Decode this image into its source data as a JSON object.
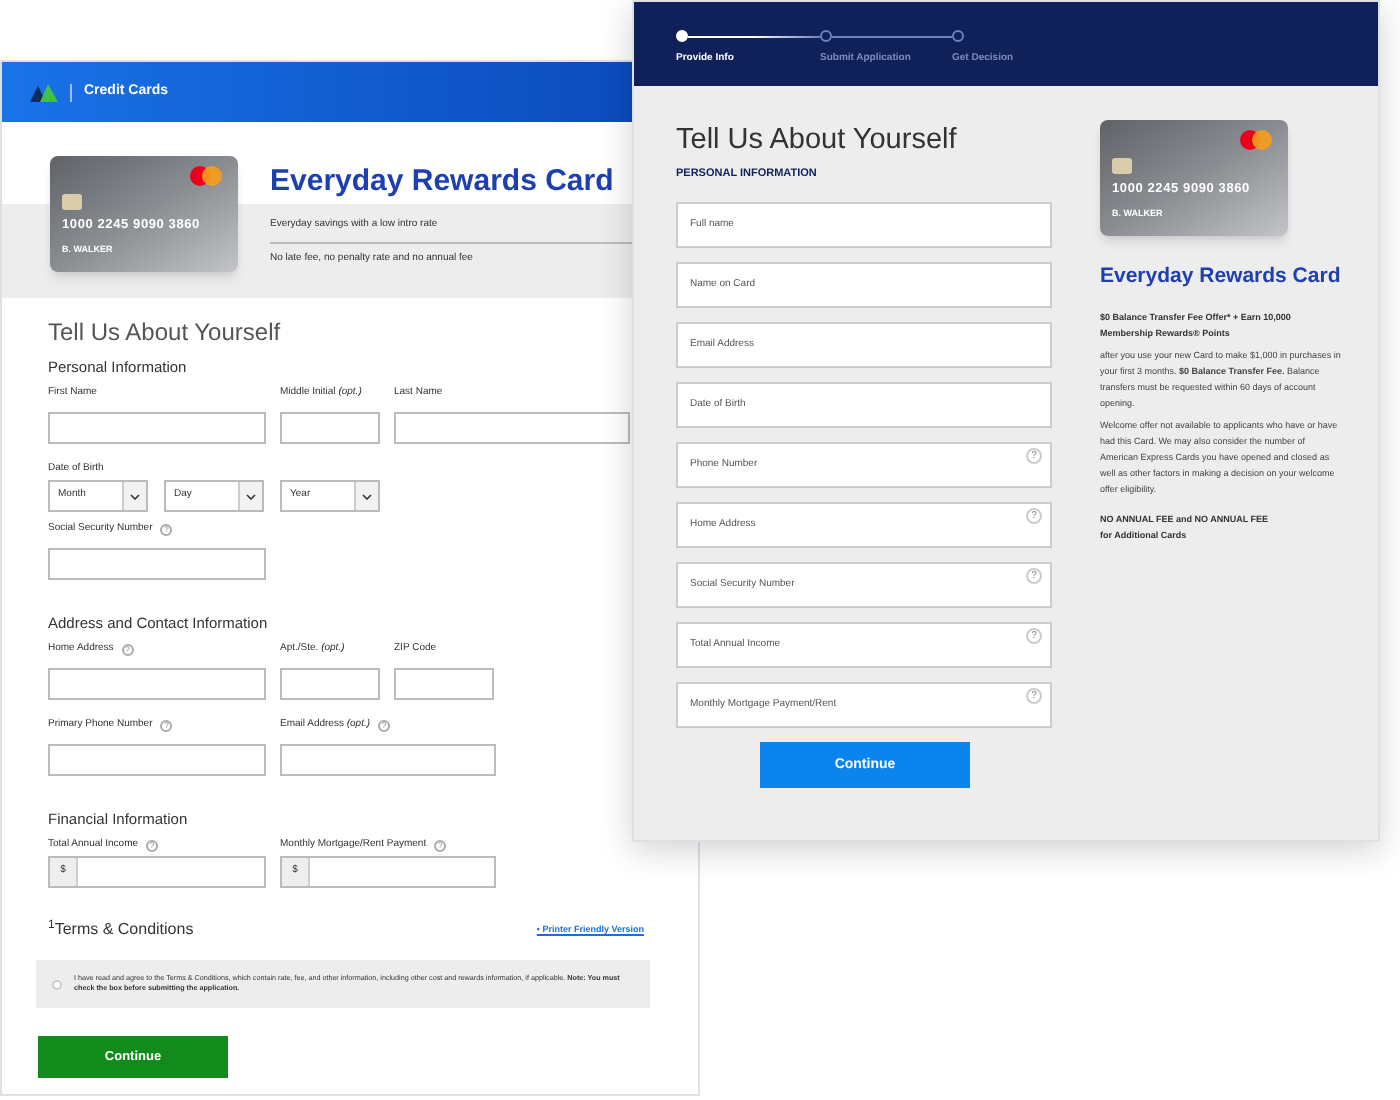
{
  "left_page": {
    "header": {
      "title": "Credit Cards"
    },
    "product": {
      "title": "Everyday Rewards Card",
      "card": {
        "number": "1000 2245 9090 3860",
        "holder": "B. WALKER"
      },
      "features": [
        "Everyday savings with a low intro rate",
        "No late fee, no penalty rate and no annual fee"
      ]
    },
    "heading": "Tell Us About Yourself",
    "sections": [
      {
        "title": "Personal Information",
        "rows": [
          [
            {
              "label": "First Name",
              "kind": "text"
            },
            {
              "label": "Middle Initial *(opt.)*",
              "kind": "text"
            },
            {
              "label": "Last Name",
              "kind": "text"
            }
          ],
          [
            {
              "label": "Date of Birth",
              "kind": "selects",
              "selects": [
                "Month",
                "Day",
                "Year"
              ]
            }
          ],
          [
            {
              "label": "Social Security Number",
              "kind": "text",
              "help": "?"
            }
          ]
        ]
      },
      {
        "title": "Address and Contact Information",
        "rows": [
          [
            {
              "label": "Home Address",
              "kind": "text",
              "help": "?"
            },
            {
              "label": "Apt./Ste. *(opt.)*",
              "kind": "text"
            },
            {
              "label": "ZIP Code",
              "kind": "text"
            }
          ],
          [
            {
              "label": "Primary Phone Number",
              "kind": "text",
              "help": "?"
            },
            {
              "label": "Email Address *(opt.)*",
              "kind": "text",
              "help": "?"
            }
          ]
        ]
      },
      {
        "title": "Financial Information",
        "rows": [
          [
            {
              "label": "Total Annual Income",
              "kind": "currency",
              "prefix": "$",
              "help": "?"
            },
            {
              "label": "Monthly Mortgage/Rent Payment",
              "kind": "currency",
              "prefix": "$",
              "help": "?"
            }
          ]
        ]
      }
    ],
    "terms": {
      "title": "$^{1}$Terms & Conditions",
      "link": "• Printer Friendly Version",
      "agreement": "I have read and agree to the Terms & Conditions, which contain rate, fee, and other information, including other cost and rewards information, if applicable. **Note: You must check the box before submitting the application.**",
      "checked": false
    },
    "button": "Continue"
  },
  "right_page": {
    "steps": [
      {
        "label": "Provide Info",
        "selected": true
      },
      {
        "label": "Submit Application",
        "selected": false
      },
      {
        "label": "Get Decision",
        "selected": false
      }
    ],
    "heading": "Tell Us About Yourself",
    "section": "PERSONAL INFORMATION",
    "fields": [
      {
        "placeholder": "Full name"
      },
      {
        "placeholder": "Name on Card"
      },
      {
        "placeholder": "Email Address"
      },
      {
        "placeholder": "Date of Birth"
      },
      {
        "placeholder": "Phone Number",
        "help": "?"
      },
      {
        "placeholder": "Home Address",
        "help": "?"
      },
      {
        "placeholder": "Social Security Number",
        "help": "?"
      },
      {
        "placeholder": "Total Annual Income",
        "help": "?"
      },
      {
        "placeholder": "Monthly Mortgage Payment/Rent",
        "help": "?"
      }
    ],
    "button": "Continue",
    "product": {
      "card": {
        "number": "1000 2245 9090 3860",
        "holder": "B. WALKER"
      },
      "title": "Everyday Rewards Card",
      "offer": "$0 Balance Transfer Fee Offer* + Earn 10,000 Membership Rewards® Points",
      "paragraphs": [
        "after you use your new Card to make $1,000 in purchases in your first 3 months. **$0 Balance Transfer Fee.** Balance transfers must be requested within 60 days of account opening.",
        "Welcome offer not available to applicants who have or have had this Card. We may also consider the number of American Express Cards you have opened and closed as well as other factors in making a decision on your welcome offer eligibility."
      ],
      "fee_note": "NO ANNUAL FEE and NO ANNUAL FEE for Additional Cards"
    }
  }
}
